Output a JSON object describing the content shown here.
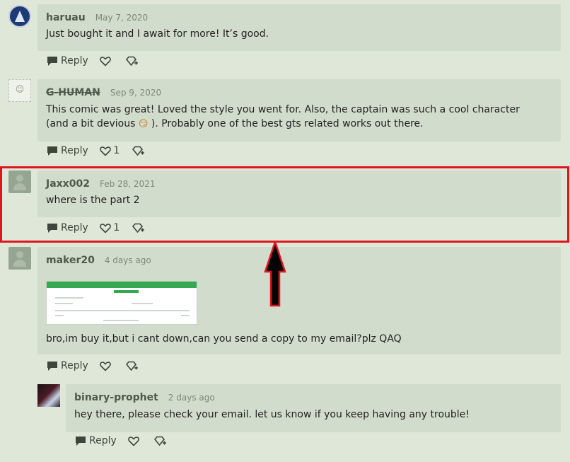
{
  "comments": [
    {
      "username": "haruau",
      "date": "May 7, 2020",
      "text": "Just bought it and I await for more! It’s good.",
      "reply": "Reply",
      "likes": ""
    },
    {
      "username": "G-HUMAN",
      "date": "Sep 9, 2020",
      "text": "This comic was great! Loved the style you went for. Also, the captain was such a cool character (and a bit devious",
      "text_after_emoji": "). Probably one of the best gts related works out there.",
      "avatar_glyph": "☺",
      "emoji": "😏",
      "reply": "Reply",
      "likes": "1"
    },
    {
      "username": "Jaxx002",
      "date": "Feb 28, 2021",
      "text": "where is the part 2",
      "reply": "Reply",
      "likes": "1"
    },
    {
      "username": "maker20",
      "date": "4 days ago",
      "text": "bro,im buy it,but i cant down,can you send a copy to my email?plz QAQ",
      "reply": "Reply",
      "likes": ""
    },
    {
      "username": "binary-prophet",
      "date": "2 days ago",
      "text": "hey there, please check your email. let us know if you keep having any trouble!",
      "reply": "Reply",
      "likes": ""
    }
  ],
  "icons": {
    "reply": "speech-bubble-icon",
    "like": "heart-icon",
    "tip": "gem-plus-icon"
  },
  "colors": {
    "background": "#dfe7d9",
    "bubble": "#d2dccc",
    "highlight": "#e0161f",
    "username": "#4f5a4c"
  }
}
